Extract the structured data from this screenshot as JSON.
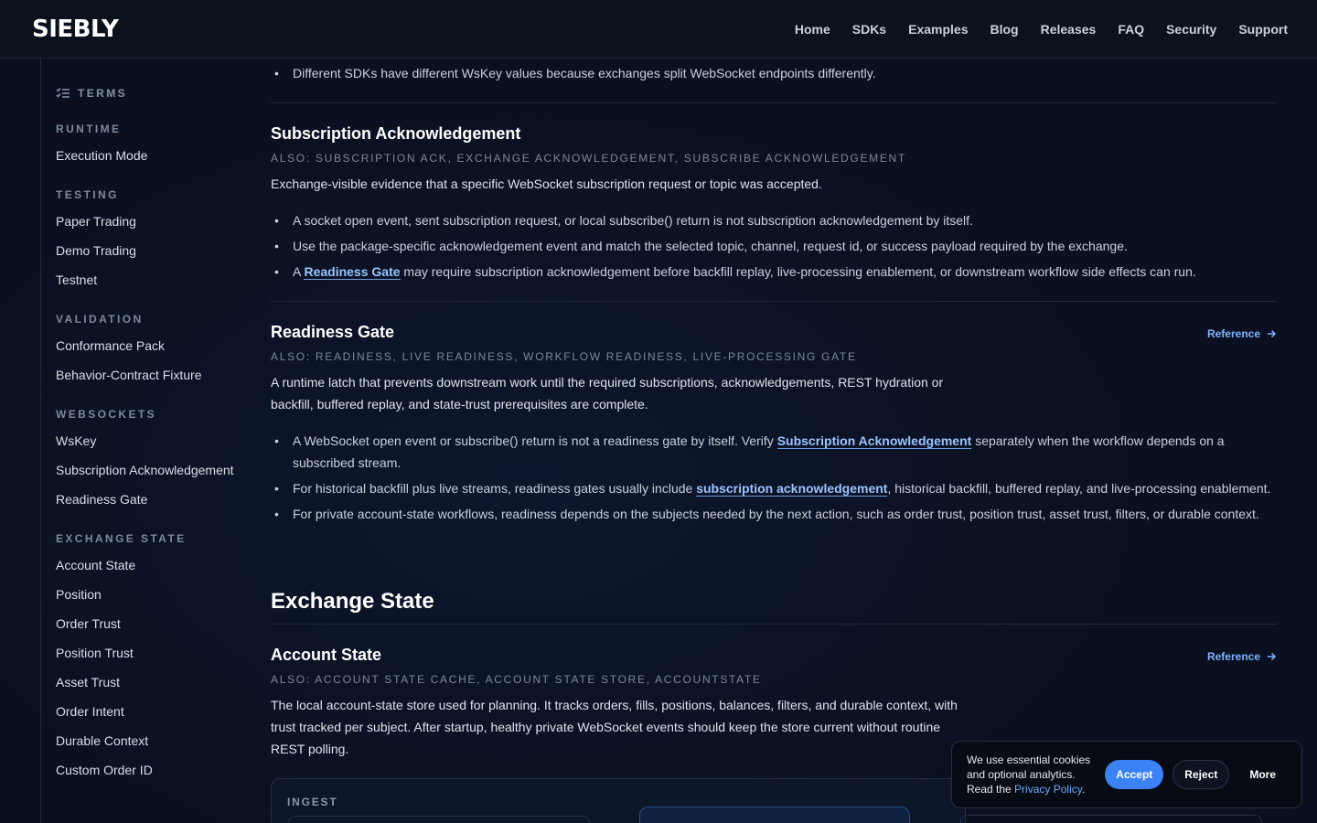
{
  "header": {
    "logo": "SIEBLY",
    "nav": [
      "Home",
      "SDKs",
      "Examples",
      "Blog",
      "Releases",
      "FAQ",
      "Security",
      "Support"
    ]
  },
  "sidebar": {
    "heading": "TERMS",
    "groups": [
      {
        "title": "RUNTIME",
        "items": [
          "Execution Mode"
        ]
      },
      {
        "title": "TESTING",
        "items": [
          "Paper Trading",
          "Demo Trading",
          "Testnet"
        ]
      },
      {
        "title": "VALIDATION",
        "items": [
          "Conformance Pack",
          "Behavior-Contract Fixture"
        ]
      },
      {
        "title": "WEBSOCKETS",
        "items": [
          "WsKey",
          "Subscription Acknowledgement",
          "Readiness Gate"
        ]
      },
      {
        "title": "EXCHANGE STATE",
        "items": [
          "Account State",
          "Position",
          "Order Trust",
          "Position Trust",
          "Asset Trust",
          "Order Intent",
          "Durable Context",
          "Custom Order ID"
        ]
      }
    ]
  },
  "top_bullet": "Different SDKs have different WsKey values because exchanges split WebSocket endpoints differently.",
  "subscription_ack": {
    "title": "Subscription Acknowledgement",
    "also": "ALSO: SUBSCRIPTION ACK, EXCHANGE ACKNOWLEDGEMENT, SUBSCRIBE ACKNOWLEDGEMENT",
    "desc": "Exchange-visible evidence that a specific WebSocket subscription request or topic was accepted.",
    "b1": "A socket open event, sent subscription request, or local subscribe() return is not subscription acknowledgement by itself.",
    "b2": "Use the package-specific acknowledgement event and match the selected topic, channel, request id, or success payload required by the exchange.",
    "b3_pre": "A ",
    "b3_link": "Readiness Gate",
    "b3_post": " may require subscription acknowledgement before backfill replay, live-processing enablement, or downstream workflow side effects can run."
  },
  "readiness_gate": {
    "title": "Readiness Gate",
    "reference": "Reference",
    "also": "ALSO: READINESS, LIVE READINESS, WORKFLOW READINESS, LIVE-PROCESSING GATE",
    "desc": "A runtime latch that prevents downstream work until the required subscriptions, acknowledgements, REST hydration or backfill, buffered replay, and state-trust prerequisites are complete.",
    "b1_pre": "A WebSocket open event or subscribe() return is not a readiness gate by itself. Verify ",
    "b1_link": "Subscription Acknowledgement",
    "b1_post": " separately when the workflow depends on a subscribed stream.",
    "b2_pre": "For historical backfill plus live streams, readiness gates usually include ",
    "b2_link": "subscription acknowledgement",
    "b2_post": ", historical backfill, buffered replay, and live-processing enablement.",
    "b3": "For private account-state workflows, readiness depends on the subjects needed by the next action, such as order trust, position trust, asset trust, filters, or durable context."
  },
  "exchange_state": {
    "section_title": "Exchange State"
  },
  "account_state": {
    "title": "Account State",
    "reference": "Reference",
    "also": "ALSO: ACCOUNT STATE CACHE, ACCOUNT STATE STORE, ACCOUNTSTATE",
    "desc": "The local account-state store used for planning. It tracks orders, fills, positions, balances, filters, and durable context, with trust tracked per subject. After startup, healthy private WebSocket events should keep the store current without routine REST polling.",
    "diagram_label": "INGEST"
  },
  "cookie": {
    "text_pre": "We use essential cookies and optional analytics. Read the ",
    "privacy": "Privacy Policy",
    "text_post": ".",
    "accept": "Accept",
    "reject": "Reject",
    "more": "More"
  }
}
